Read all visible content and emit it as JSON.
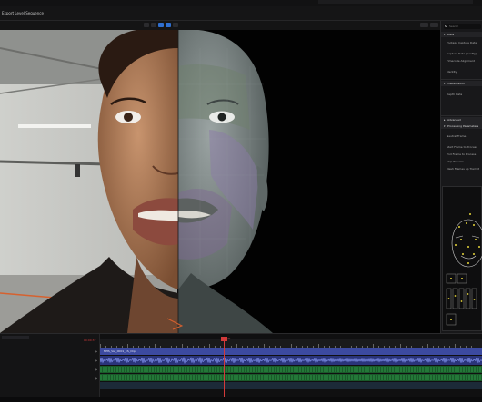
{
  "header": {
    "title": "Export Level Sequence"
  },
  "right_panel": {
    "search_placeholder": "Search",
    "sections": [
      {
        "label": "Data",
        "items": [
          "Footage Capture Data",
          "Capture Data (Config)",
          "Timecode Alignment",
          "Identity"
        ]
      },
      {
        "label": "Visualization",
        "items": [
          "Depth Data"
        ]
      },
      {
        "label": "Advanced",
        "items": []
      },
      {
        "label": "Processing Parameters",
        "items": [
          "Neutral Frame",
          "Start Frame to Process",
          "End Frame to Process",
          "Skip Preview",
          "Mesh Frames up Trail Fit"
        ]
      }
    ]
  },
  "timeline": {
    "clip_name": "MHS_Ver_0001_CS_Clip",
    "playhead_frame": "37",
    "current_time": "00:00:37"
  },
  "colors": {
    "accent": "#2f6fd0",
    "playhead": "#d23a3a",
    "audio_wave": "#5a6fd0",
    "green_track": "#2fb04a"
  }
}
